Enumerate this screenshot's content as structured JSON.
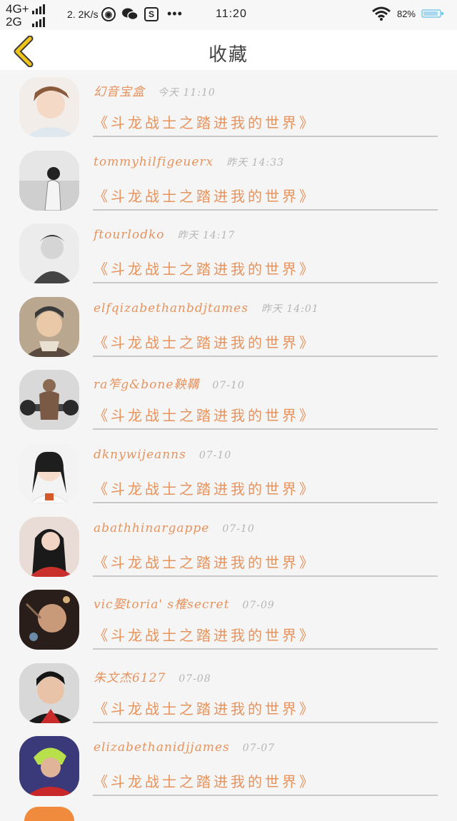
{
  "status_bar": {
    "network_top": "4G+",
    "network_bottom": "2G",
    "speed": "2. 2K/s",
    "time": "11:20",
    "battery": "82%"
  },
  "header": {
    "back_icon": "chevron-left-icon",
    "title": "收藏"
  },
  "colors": {
    "accent": "#e7935d",
    "back": "#f0c419",
    "muted": "#b5b5b5",
    "divider": "#c9c9c9"
  },
  "items": [
    {
      "name": "幻音宝盒",
      "time": "今天 11:10",
      "book": "《斗龙战士之踏进我的世界》"
    },
    {
      "name": "tommyhilfigeuerx",
      "time": "昨天 14:33",
      "book": "《斗龙战士之踏进我的世界》"
    },
    {
      "name": "ftourlodko",
      "time": "昨天 14:17",
      "book": "《斗龙战士之踏进我的世界》"
    },
    {
      "name": "elfqizabethanbdjtames",
      "time": "昨天 14:01",
      "book": "《斗龙战士之踏进我的世界》"
    },
    {
      "name": "ra笮g&bone鞅鞲",
      "time": "07-10",
      "book": "《斗龙战士之踏进我的世界》"
    },
    {
      "name": "dknywijeanns",
      "time": "07-10",
      "book": "《斗龙战士之踏进我的世界》"
    },
    {
      "name": "abathhinargappe",
      "time": "07-10",
      "book": "《斗龙战士之踏进我的世界》"
    },
    {
      "name": "vic娶toria' s榷secret",
      "time": "07-09",
      "book": "《斗龙战士之踏进我的世界》"
    },
    {
      "name": "朱文杰6127",
      "time": "07-08",
      "book": "《斗龙战士之踏进我的世界》"
    },
    {
      "name": "elizabethanidjjames",
      "time": "07-07",
      "book": "《斗龙战士之踏进我的世界》"
    }
  ]
}
